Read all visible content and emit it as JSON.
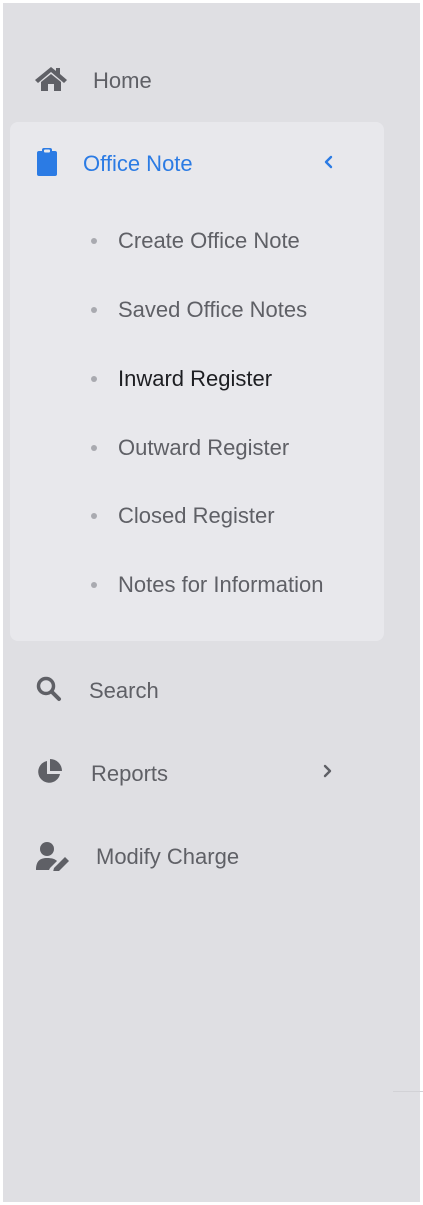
{
  "nav": {
    "home": {
      "label": "Home",
      "icon": "home-icon"
    },
    "office_note": {
      "label": "Office Note",
      "icon": "clipboard-icon",
      "expanded": true,
      "accent": "#2b7be4",
      "children": [
        {
          "label": "Create Office Note",
          "active": false
        },
        {
          "label": "Saved Office Notes",
          "active": false
        },
        {
          "label": "Inward Register",
          "active": true
        },
        {
          "label": "Outward Register",
          "active": false
        },
        {
          "label": "Closed Register",
          "active": false
        },
        {
          "label": "Notes for Information",
          "active": false
        }
      ]
    },
    "search": {
      "label": "Search",
      "icon": "search-icon"
    },
    "reports": {
      "label": "Reports",
      "icon": "pie-chart-icon"
    },
    "modify_charge": {
      "label": "Modify Charge",
      "icon": "user-edit-icon"
    }
  },
  "colors": {
    "sidebar_bg": "#dfdfe3",
    "group_bg": "#e8e8ec",
    "text": "#5f6066",
    "active_text": "#1d1e22",
    "accent": "#2b7be4"
  }
}
